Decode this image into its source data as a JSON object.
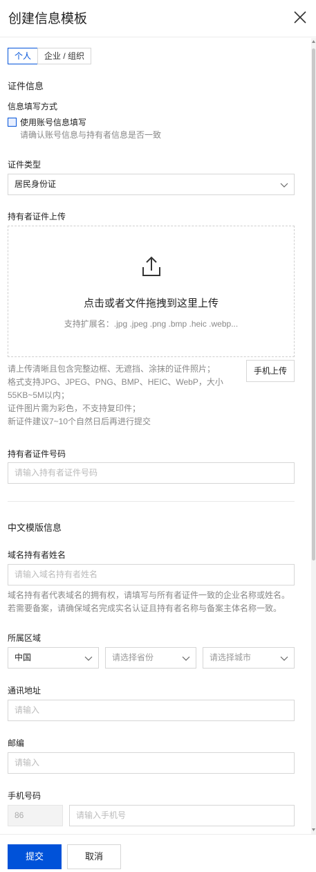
{
  "header": {
    "title": "创建信息模板",
    "close_icon": "close-icon"
  },
  "tabs": [
    {
      "label": "个人",
      "active": true
    },
    {
      "label": "企业 / 组织",
      "active": false
    }
  ],
  "cert": {
    "section_title": "证件信息",
    "fill_method_label": "信息填写方式",
    "use_account_checkbox": "使用账号信息填写",
    "use_account_hint": "请确认账号信息与持有者信息是否一致",
    "cert_type_label": "证件类型",
    "cert_type_value": "居民身份证",
    "upload_label": "持有者证件上传",
    "upload_main": "点击或者文件拖拽到这里上传",
    "upload_sub": "支持扩展名：.jpg .jpeg .png .bmp .heic .webp...",
    "upload_hints": [
      "请上传清晰且包含完整边框、无遮挡、涂抹的证件照片；",
      "格式支持JPG、JPEG、PNG、BMP、HEIC、WebP，大小",
      "55KB~5M以内；",
      "证件图片需为彩色，不支持复印件；",
      "新证件建议7~10个自然日后再进行提交"
    ],
    "mobile_upload_button": "手机上传",
    "cert_number_label": "持有者证件号码",
    "cert_number_placeholder": "请输入持有者证件号码"
  },
  "template": {
    "section_title": "中文模版信息",
    "owner_name_label": "域名持有者姓名",
    "owner_name_placeholder": "请输入域名持有者姓名",
    "owner_name_hints": [
      "域名持有者代表域名的拥有权，请填写与所有者证件一致的企业名称或姓名。",
      "若需要备案，请确保域名完成实名认证且持有者名称与备案主体名称一致。"
    ],
    "region_label": "所属区域",
    "region_country": "中国",
    "region_province_placeholder": "请选择省份",
    "region_city_placeholder": "请选择城市",
    "address_label": "通讯地址",
    "address_placeholder": "请输入",
    "postcode_label": "邮编",
    "postcode_placeholder": "请输入",
    "phone_label": "手机号码",
    "phone_prefix": "86",
    "phone_placeholder": "请输入手机号"
  },
  "footer": {
    "submit_label": "提交",
    "cancel_label": "取消"
  },
  "colors": {
    "primary": "#0052d9"
  }
}
